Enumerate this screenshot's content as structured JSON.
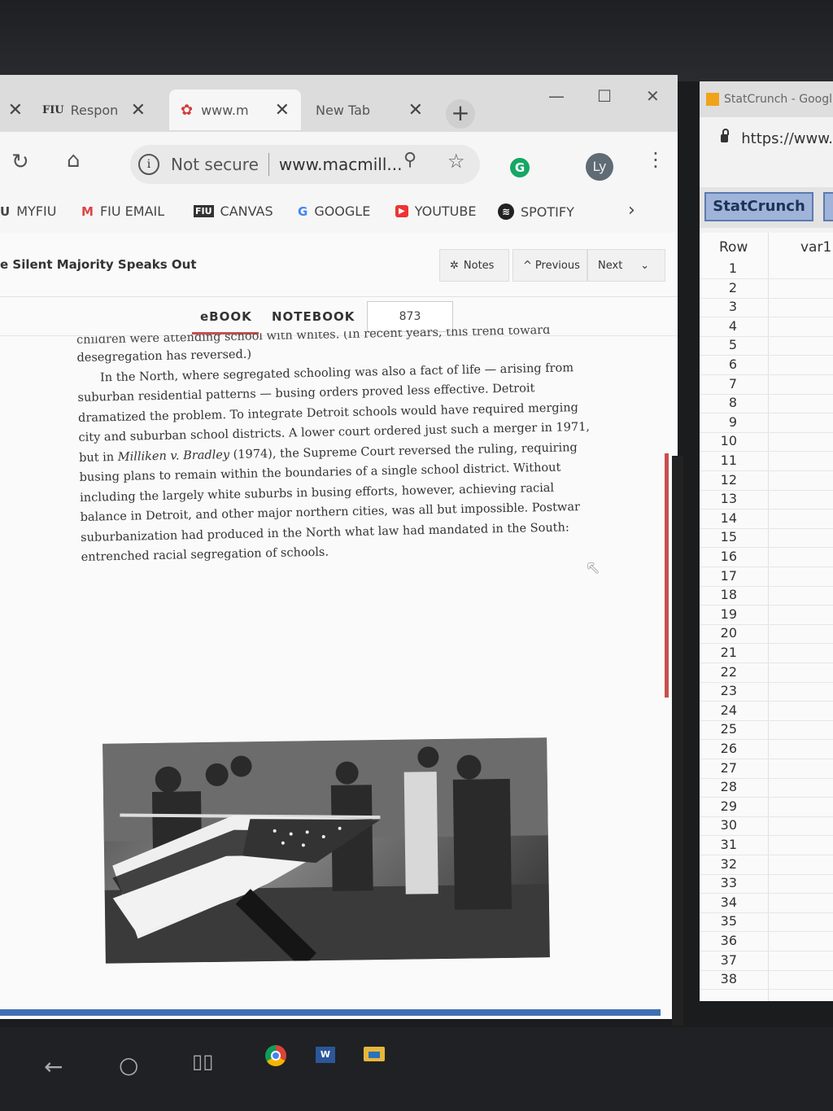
{
  "browser": {
    "tabs": [
      {
        "label": "Respon",
        "favicon": "FIU"
      },
      {
        "label": "www.m",
        "favicon": "macmillan-logo-icon"
      },
      {
        "label": "New Tab",
        "favicon": ""
      }
    ],
    "address": {
      "security": "Not secure",
      "url": "www.macmill..."
    },
    "profile_initials": "Ly",
    "grammarly_letter": "G"
  },
  "bookmarks": [
    {
      "label": "MYFIU",
      "icon": "U"
    },
    {
      "label": "FIU EMAIL",
      "icon": "M"
    },
    {
      "label": "CANVAS",
      "icon": "FIU"
    },
    {
      "label": "GOOGLE",
      "icon": "G"
    },
    {
      "label": "YOUTUBE",
      "icon": "▶"
    },
    {
      "label": "SPOTIFY",
      "icon": "≋"
    }
  ],
  "reader": {
    "chapter_title": "e Silent Majority Speaks Out",
    "notes_label": "Notes",
    "previous_label": "Previous",
    "next_label": "Next",
    "tab_ebook": "eBOOK",
    "tab_notebook": "NOTEBOOK",
    "page_number": "873",
    "cut_line": "children were attending school with whites. (In recent years, this trend toward",
    "line_desegregation": "desegregation has reversed.)",
    "para_start": "In the North, where segregated schooling was also a fact of life — arising from suburban residential patterns — busing orders proved less effective. Detroit dramatized the problem. To integrate Detroit schools would have required merging city and suburban school districts. A lower court ordered just such a merger in 1971, but in ",
    "case_name": "Milliken v. Bradley",
    "para_end": " (1974), the Supreme Court reversed the ruling, requiring busing plans to remain within the boundaries of a single school district. Without including the largely white suburbs in busing efforts, however, achieving racial balance in Detroit, and other major northern cities, was all but impossible. Postwar suburbanization had produced in the North what law had mandated in the South: entrenched racial segregation of schools."
  },
  "statcrunch": {
    "tab_title": "StatCrunch - Googl",
    "url": "https://www.",
    "button_label": "StatCrunch",
    "col_row": "Row",
    "col_var1": "var1",
    "rows": [
      "1",
      "2",
      "3",
      "4",
      "5",
      "6",
      "7",
      "8",
      "9",
      "10",
      "11",
      "12",
      "13",
      "14",
      "15",
      "16",
      "17",
      "18",
      "19",
      "20",
      "21",
      "22",
      "23",
      "24",
      "25",
      "26",
      "27",
      "28",
      "29",
      "30",
      "31",
      "32",
      "33",
      "34",
      "35",
      "36",
      "37",
      "38"
    ]
  },
  "colors": {
    "accent_red": "#c8504e",
    "statcrunch_blue": "#9fb4d8",
    "taskbar": "#202124"
  }
}
